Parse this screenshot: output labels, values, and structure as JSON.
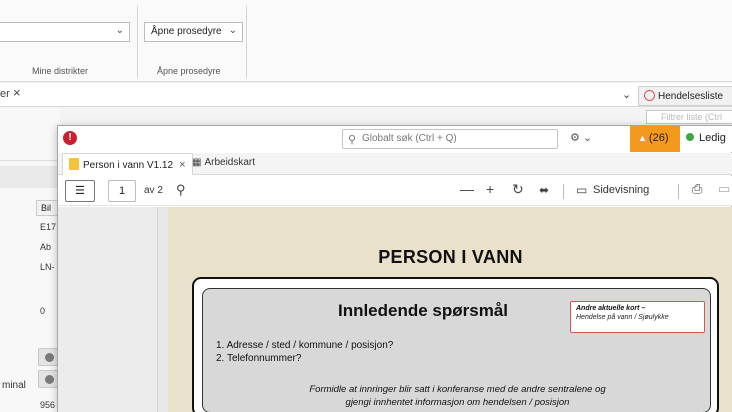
{
  "background": {
    "district_dropdown_chevron": "⌄",
    "district_group_label": "Mine distrikter",
    "procedure_dropdown": "Åpne prosedyre",
    "procedure_group_label": "Åpne prosedyre",
    "tab_partial": "er",
    "tab_close": "×",
    "tab_chevron": "⌄",
    "hendelse_tab": "Hendelsesliste",
    "filter_placeholder": "Filtrer liste (Ctrl",
    "left_cells": [
      "Bil",
      "E17",
      "Ab",
      "LN-",
      "0",
      "956"
    ],
    "left_label_minal": "minal"
  },
  "window": {
    "global_search_placeholder": "Globalt søk (Ctrl + Q)",
    "notification_count": "(26)",
    "status": "Ledig",
    "colors": {
      "logo": "#cc1f2d",
      "notification": "#f39a1e",
      "status_dot": "#3aa845"
    }
  },
  "doc_tabs": [
    {
      "label": "Person i vann V1.12",
      "active": true
    },
    {
      "label": "Arbeidskart",
      "active": false
    }
  ],
  "pdf_toolbar": {
    "page": "1",
    "page_total": "av 2",
    "view_label": "Sidevisning"
  },
  "document": {
    "title": "PERSON I VANN",
    "section_title": "Innledende spørsmål",
    "other_cards_title": "Andre aktuelle kort –",
    "other_cards_items": "Hendelse på vann / Sjøulykke",
    "questions": [
      "1.  Adresse / sted / kommune / posisjon?",
      "2.  Telefonnummer?"
    ],
    "note_line1": "Formidle at innringer blir satt i konferanse med de andre sentralene og",
    "note_line2": "gjengi innhentet informasjon om hendelsen / posisjon"
  }
}
